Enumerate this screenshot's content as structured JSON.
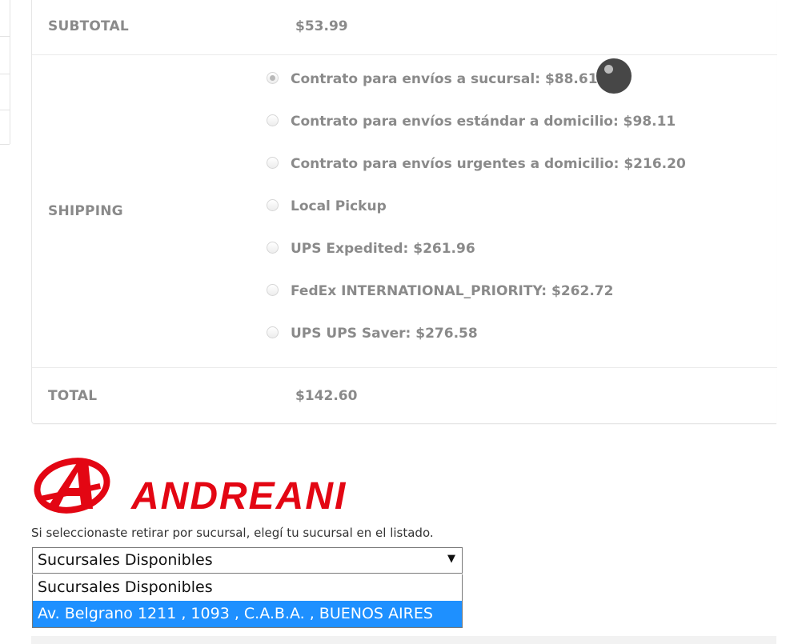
{
  "totals": {
    "subtotal_label": "SUBTOTAL",
    "subtotal_value": "$53.99",
    "shipping_label": "SHIPPING",
    "shipping_options": [
      {
        "label": "Contrato para envíos a sucursal: $88.61",
        "checked": true
      },
      {
        "label": "Contrato para envíos estándar a domicilio: $98.11",
        "checked": false
      },
      {
        "label": "Contrato para envíos urgentes a domicilio: $216.20",
        "checked": false
      },
      {
        "label": "Local Pickup",
        "checked": false
      },
      {
        "label": "UPS Expedited: $261.96",
        "checked": false
      },
      {
        "label": "FedEx INTERNATIONAL_PRIORITY: $262.72",
        "checked": false
      },
      {
        "label": "UPS UPS Saver: $276.58",
        "checked": false
      }
    ],
    "total_label": "TOTAL",
    "total_value": "$142.60"
  },
  "andreani": {
    "logo_text": "ANDREANI",
    "brand_color": "#e30613",
    "hint": "Si seleccionaste retirar por sucursal, elegí tu sucursal en el listado.",
    "select_value": "Sucursales Disponibles",
    "select_arrow": "▼",
    "options": [
      {
        "label": "Sucursales Disponibles",
        "highlighted": false
      },
      {
        "label": "Av. Belgrano 1211 , 1093 , C.A.B.A. , BUENOS AIRES",
        "highlighted": true
      }
    ],
    "highlight_color": "#1e90ff"
  }
}
